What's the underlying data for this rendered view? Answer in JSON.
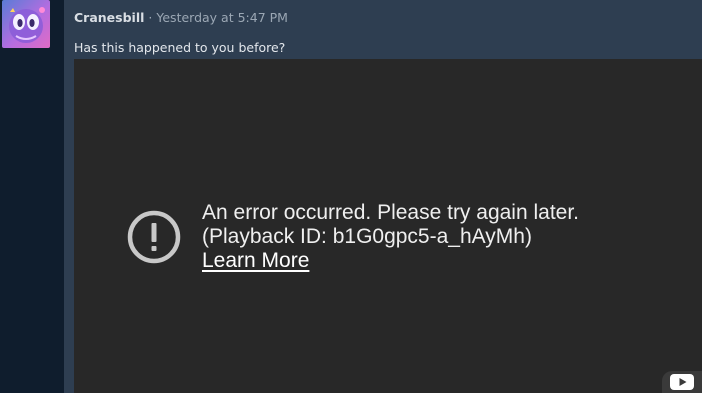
{
  "message": {
    "author": "Cranesbill",
    "separator": "·",
    "timestamp": "Yesterday at 5:47 PM",
    "text": "Has this happened to you before?"
  },
  "video_embed": {
    "error_line1": "An error occurred. Please try again later.",
    "error_line2": "(Playback ID: b1G0gpc5-a_hAyMh)",
    "learn_more": "Learn More",
    "icons": {
      "error": "exclamation-circle-icon",
      "youtube": "youtube-play-icon"
    }
  },
  "colors": {
    "sidebar": "#0f1d2d",
    "message_bg": "#2e3e51",
    "video_bg": "#282828",
    "error_icon": "#c8c8c8"
  }
}
